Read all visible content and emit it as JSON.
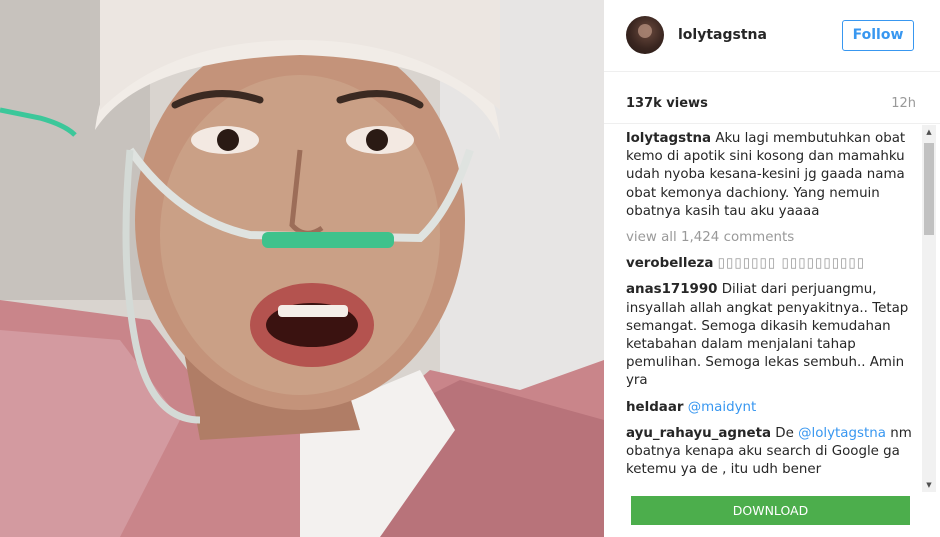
{
  "post": {
    "username": "lolytagstna",
    "follow_label": "Follow",
    "views": "137k views",
    "time_ago": "12h",
    "caption_user": "lolytagstna",
    "caption_text": "Aku lagi membutuhkan obat kemo di apotik sini kosong dan mamahku udah nyoba kesana-kesini jg gaada nama obat kemonya dachiony. Yang nemuin obatnya kasih tau aku yaaaa",
    "view_all_comments": "view all 1,424 comments"
  },
  "comments": [
    {
      "user": "verobelleza",
      "text": "▯▯▯▯▯▯▯ ▯▯▯▯▯▯▯▯▯▯"
    },
    {
      "user": "anas171990",
      "text": "Diliat dari perjuangmu, insyallah allah angkat penyakitnya.. Tetap semangat. Semoga dikasih kemudahan ketabahan dalam menjalani tahap pemulihan. Semoga lekas sembuh.. Amin yra"
    },
    {
      "user": "heldaar",
      "mention": "@maidynt"
    },
    {
      "user": "ayu_rahayu_agneta",
      "text_before": "De",
      "mention": "@lolytagstna",
      "text_after": "nm obatnya kenapa aku search di Google ga ketemu ya de , itu udh bener"
    }
  ],
  "download_label": "DOWNLOAD",
  "colors": {
    "accent_blue": "#3897f0",
    "download_green": "#4cae4c",
    "muted_gray": "#999999"
  }
}
